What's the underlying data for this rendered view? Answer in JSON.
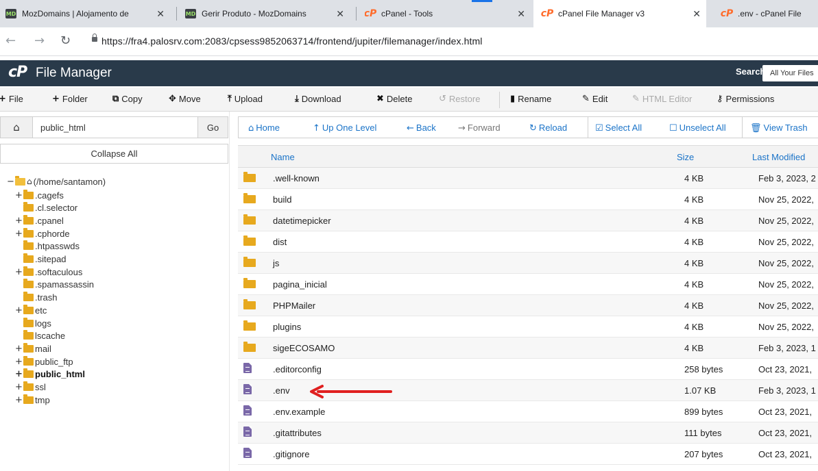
{
  "browser": {
    "tabs": [
      {
        "title": "MozDomains | Alojamento de",
        "favicon": "moz-icon",
        "active": false
      },
      {
        "title": "Gerir Produto - MozDomains",
        "favicon": "moz-icon",
        "active": false
      },
      {
        "title": "cPanel - Tools",
        "favicon": "cpanel-icon",
        "active": false
      },
      {
        "title": "cPanel File Manager v3",
        "favicon": "cpanel-icon",
        "active": true
      },
      {
        "title": ".env - cPanel File",
        "favicon": "cpanel-icon",
        "active": false
      }
    ],
    "url": "https://fra4.palosrv.com:2083/cpsess9852063714/frontend/jupiter/filemanager/index.html"
  },
  "header": {
    "logo": "cP",
    "title": "File Manager",
    "search_label": "Search",
    "search_scope": "All Your Files"
  },
  "toolbar": {
    "file": "File",
    "folder": "Folder",
    "copy": "Copy",
    "move": "Move",
    "upload": "Upload",
    "download": "Download",
    "delete": "Delete",
    "restore": "Restore",
    "rename": "Rename",
    "edit": "Edit",
    "html_editor": "HTML Editor",
    "permissions": "Permissions"
  },
  "left": {
    "path_value": "public_html",
    "go": "Go",
    "collapse_all": "Collapse All",
    "root": "(/home/santamon)",
    "tree": [
      {
        "name": ".cagefs",
        "plus": true
      },
      {
        "name": ".cl.selector",
        "plus": false
      },
      {
        "name": ".cpanel",
        "plus": true
      },
      {
        "name": ".cphorde",
        "plus": true
      },
      {
        "name": ".htpasswds",
        "plus": false
      },
      {
        "name": ".sitepad",
        "plus": false
      },
      {
        "name": ".softaculous",
        "plus": true
      },
      {
        "name": ".spamassassin",
        "plus": false
      },
      {
        "name": ".trash",
        "plus": false
      },
      {
        "name": "etc",
        "plus": true
      },
      {
        "name": "logs",
        "plus": false
      },
      {
        "name": "lscache",
        "plus": false
      },
      {
        "name": "mail",
        "plus": true
      },
      {
        "name": "public_ftp",
        "plus": true
      },
      {
        "name": "public_html",
        "plus": true,
        "bold": true
      },
      {
        "name": "ssl",
        "plus": true
      },
      {
        "name": "tmp",
        "plus": true
      }
    ]
  },
  "nav": {
    "home": "Home",
    "up": "Up One Level",
    "back": "Back",
    "forward": "Forward",
    "reload": "Reload",
    "select_all": "Select All",
    "unselect_all": "Unselect All",
    "view_trash": "View Trash"
  },
  "table": {
    "headers": {
      "name": "Name",
      "size": "Size",
      "modified": "Last Modified"
    },
    "rows": [
      {
        "type": "folder",
        "name": ".well-known",
        "size": "4 KB",
        "modified": "Feb 3, 2023, 2"
      },
      {
        "type": "folder",
        "name": "build",
        "size": "4 KB",
        "modified": "Nov 25, 2022,"
      },
      {
        "type": "folder",
        "name": "datetimepicker",
        "size": "4 KB",
        "modified": "Nov 25, 2022,"
      },
      {
        "type": "folder",
        "name": "dist",
        "size": "4 KB",
        "modified": "Nov 25, 2022,"
      },
      {
        "type": "folder",
        "name": "js",
        "size": "4 KB",
        "modified": "Nov 25, 2022,"
      },
      {
        "type": "folder",
        "name": "pagina_inicial",
        "size": "4 KB",
        "modified": "Nov 25, 2022,"
      },
      {
        "type": "folder",
        "name": "PHPMailer",
        "size": "4 KB",
        "modified": "Nov 25, 2022,"
      },
      {
        "type": "folder",
        "name": "plugins",
        "size": "4 KB",
        "modified": "Nov 25, 2022,"
      },
      {
        "type": "folder",
        "name": "sigeECOSAMO",
        "size": "4 KB",
        "modified": "Feb 3, 2023, 1"
      },
      {
        "type": "file",
        "name": ".editorconfig",
        "size": "258 bytes",
        "modified": "Oct 23, 2021,"
      },
      {
        "type": "file",
        "name": ".env",
        "size": "1.07 KB",
        "modified": "Feb 3, 2023, 1"
      },
      {
        "type": "file",
        "name": ".env.example",
        "size": "899 bytes",
        "modified": "Oct 23, 2021,"
      },
      {
        "type": "file",
        "name": ".gitattributes",
        "size": "111 bytes",
        "modified": "Oct 23, 2021,"
      },
      {
        "type": "file",
        "name": ".gitignore",
        "size": "207 bytes",
        "modified": "Oct 23, 2021,"
      }
    ]
  },
  "colors": {
    "header_bg": "#293a4a",
    "link": "#1a73c8",
    "folder": "#e7a91e",
    "file": "#7a68a8",
    "annotation_arrow": "#e02020"
  }
}
